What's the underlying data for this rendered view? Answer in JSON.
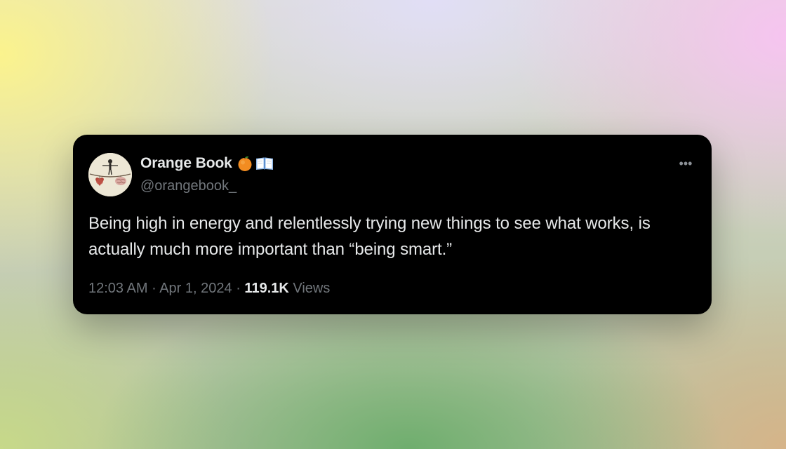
{
  "tweet": {
    "author": {
      "display_name": "Orange Book",
      "handle": "@orangebook_",
      "avatar": "tightrope-walker-avatar",
      "badges": [
        "orange-emoji-icon",
        "open-book-emoji-icon"
      ]
    },
    "text": "Being high in energy and relentlessly trying new things to see what works, is actually much more important than “being smart.”",
    "time": "12:03 AM",
    "separator": "·",
    "date": "Apr 1, 2024",
    "views_count": "119.1K",
    "views_label": "Views",
    "more_icon": "more-horizontal-icon"
  }
}
